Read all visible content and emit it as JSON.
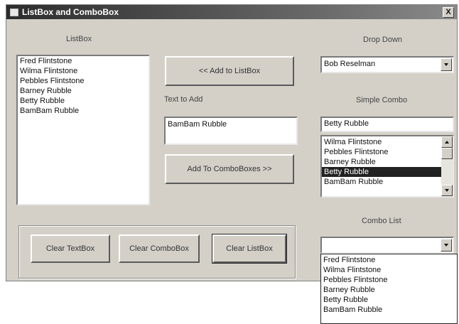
{
  "window": {
    "title": "ListBox and ComboBox",
    "close_glyph": "X"
  },
  "listbox": {
    "label": "ListBox",
    "items": [
      "Fred Flintstone",
      "Wilma Flintstone",
      "Pebbles Flintstone",
      "Barney Rubble",
      "Betty Rubble",
      "BamBam Rubble"
    ]
  },
  "middle": {
    "add_to_listbox": "<< Add to ListBox",
    "text_to_add_label": "Text to Add",
    "text_to_add_value": "BamBam Rubble",
    "add_to_comboboxes": "Add To ComboBoxes >>"
  },
  "drop_down": {
    "label": "Drop Down",
    "selected": "Bob Reselman"
  },
  "simple_combo": {
    "label": "Simple Combo",
    "edit_value": "Betty Rubble",
    "items": [
      "Wilma Flintstone",
      "Pebbles Flintstone",
      "Barney Rubble",
      "Betty Rubble",
      "BamBam Rubble"
    ],
    "selected_index": 3
  },
  "combo_list": {
    "label": "Combo List",
    "edit_value": "",
    "items": [
      "Fred Flintstone",
      "Wilma Flintstone",
      "Pebbles Flintstone",
      "Barney Rubble",
      "Betty Rubble",
      "BamBam Rubble"
    ]
  },
  "bottom_buttons": {
    "clear_textbox": "Clear TextBox",
    "clear_combobox": "Clear ComboBox",
    "clear_listbox": "Clear ListBox"
  }
}
